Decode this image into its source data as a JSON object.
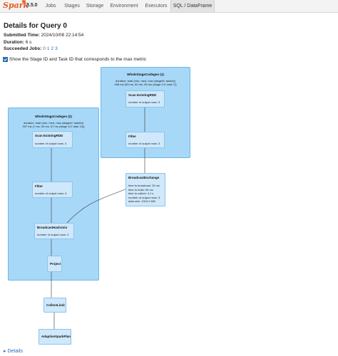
{
  "nav": {
    "brand": "Spark",
    "version": "3.5.0",
    "tabs": [
      "Jobs",
      "Stages",
      "Storage",
      "Environment",
      "Executors",
      "SQL / DataFrame"
    ]
  },
  "page": {
    "title": "Details for Query 0",
    "submitted_label": "Submitted Time:",
    "submitted_value": "2024/10/08 22:14:54",
    "duration_label": "Duration:",
    "duration_value": "6 s",
    "succeeded_label": "Succeeded Jobs:",
    "jobs": [
      "0",
      "1",
      "2",
      "3"
    ],
    "checkbox_label": "Show the Stage ID and Task ID that corresponds to the max metric",
    "details_link": "Details"
  },
  "dag": {
    "cluster1": {
      "title": "WholeStageCodegen (1)",
      "metric1": "duration: total (min, med, max (stageId: taskId))",
      "metric2": "458 ms (53 ms, 60 ms, 60 ms (stage 0.0: task 7))"
    },
    "cluster2": {
      "title": "WholeStageCodegen (2)",
      "metric1": "duration: total (min, med, max (stageId: taskId))",
      "metric2": "397 ms (7 ms, 54 ms, 67 ms (stage 3.0: task 14))"
    },
    "nodes": {
      "scan1": {
        "title": "Scan ExistingRDD",
        "metrics": [
          "number of output rows: 3"
        ]
      },
      "filter1": {
        "title": "Filter",
        "metrics": [
          "number of output rows: 3"
        ]
      },
      "scan2": {
        "title": "Scan ExistingRDD",
        "metrics": [
          "number of output rows: 4"
        ]
      },
      "filter2": {
        "title": "Filter",
        "metrics": [
          "number of output rows: 4"
        ]
      },
      "bhj": {
        "title": "BroadcastHashJoin",
        "metrics": [
          "number of output rows: 4"
        ]
      },
      "project": {
        "title": "Project",
        "metrics": []
      },
      "exchange": {
        "title": "BroadcastExchange",
        "metrics": [
          "time to broadcast: 15 ms",
          "time to build: 90 ms",
          "time to collect: 4.1 s",
          "number of output rows: 3",
          "data size: 1024.0 KiB"
        ]
      },
      "collect": {
        "title": "CollectLimit",
        "metrics": []
      },
      "adaptive": {
        "title": "AdaptiveSparkPlan",
        "metrics": []
      }
    }
  }
}
